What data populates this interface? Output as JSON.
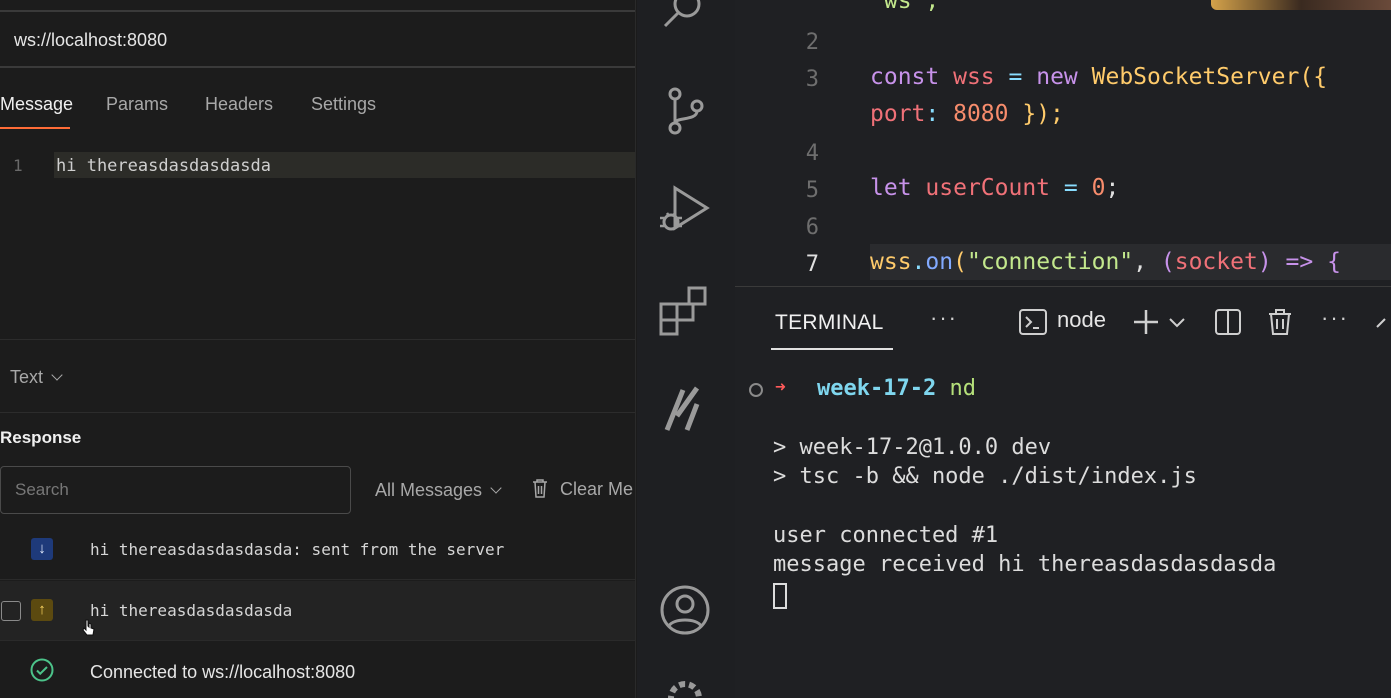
{
  "client": {
    "url": "ws://localhost:8080",
    "tabs": [
      {
        "label": "Message"
      },
      {
        "label": "Params"
      },
      {
        "label": "Headers"
      },
      {
        "label": "Settings"
      }
    ],
    "editor": {
      "line_number": "1",
      "content": "hi thereasdasdasdasda"
    },
    "format": "Text",
    "response": {
      "title": "Response",
      "search_placeholder": "Search",
      "filter": "All Messages",
      "clear_label": "Clear Me",
      "messages": [
        {
          "direction": "incoming",
          "text": "hi thereasdasdasdasda: sent from the server"
        },
        {
          "direction": "outgoing",
          "text": "hi thereasdasdasdasda"
        }
      ],
      "status": "Connected to ws://localhost:8080"
    }
  },
  "editor_code": {
    "line1_fragment": "\"ws\";",
    "line_numbers": [
      "2",
      "3",
      "4",
      "5",
      "6",
      "7"
    ],
    "line3a": {
      "kw": "const",
      "id": "wss",
      "op": "=",
      "kw2": "new",
      "cls": "WebSocketServer",
      "punc": "({"
    },
    "line3b": {
      "prop": "port",
      "colon": ":",
      "num": "8080",
      "punc": "});"
    },
    "line5": {
      "kw": "let",
      "id": "userCount",
      "op": "=",
      "num": "0",
      "punc": ";"
    },
    "line7": {
      "obj": "wss",
      "dot": ".",
      "meth": "on",
      "p1": "(",
      "str": "\"connection\"",
      "comma": ",",
      "p2": "(",
      "param": "socket",
      "p3": ")",
      "arrow": "=>",
      "brace": "{"
    }
  },
  "terminal": {
    "tab": "TERMINAL",
    "more": "···",
    "shell": "node",
    "prompt_dir": "week-17-2",
    "prompt_cmd": "nd",
    "prompt_arrow": "➜",
    "lines": [
      "> week-17-2@1.0.0 dev",
      "> tsc -b && node ./dist/index.js",
      "",
      "user connected #1",
      "message received hi thereasdasdasdasda"
    ]
  },
  "icons": {
    "activity": [
      "search-icon",
      "source-control-icon",
      "run-debug-icon",
      "extensions-icon",
      "cursor-ai-icon",
      "account-icon",
      "settings-gear-icon"
    ],
    "panel": [
      "terminal-icon",
      "plus-icon",
      "chevron-down-icon",
      "split-terminal-icon",
      "trash-icon",
      "more-icon",
      "maximize-icon"
    ]
  },
  "colors": {
    "accent": "#ff6c37",
    "keyword": "#c792ea",
    "identifier": "#f07178",
    "class": "#ffcb6b",
    "number": "#f78c6c",
    "string": "#c3e88d",
    "terminal_dir": "#7fd6ee"
  }
}
